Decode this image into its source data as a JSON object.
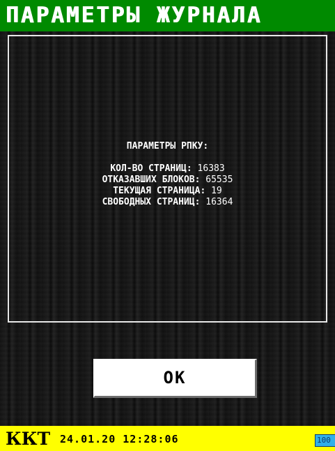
{
  "title": "ПАРАМЕТРЫ ЖУРНАЛА",
  "info": {
    "heading": "ПАРАМЕТРЫ РПКУ:",
    "lines": [
      {
        "label": "КОЛ-ВО СТРАНИЦ:",
        "value": "16383"
      },
      {
        "label": "ОТКАЗАВШИХ БЛОКОВ:",
        "value": "65535"
      },
      {
        "label": "ТЕКУЩАЯ СТРАНИЦА:",
        "value": "19"
      },
      {
        "label": "СВОБОДНЫХ СТРАНИЦ:",
        "value": "16364"
      }
    ]
  },
  "ok_button": {
    "label": "OK"
  },
  "status_bar": {
    "app_label": "ККТ",
    "datetime": "24.01.20 12:28:06",
    "battery": "100"
  },
  "colors": {
    "title_bar_bg": "#008a00",
    "status_bar_bg": "#ffff00",
    "battery_bg": "#30b0e8",
    "screen_bg": "#141414"
  }
}
